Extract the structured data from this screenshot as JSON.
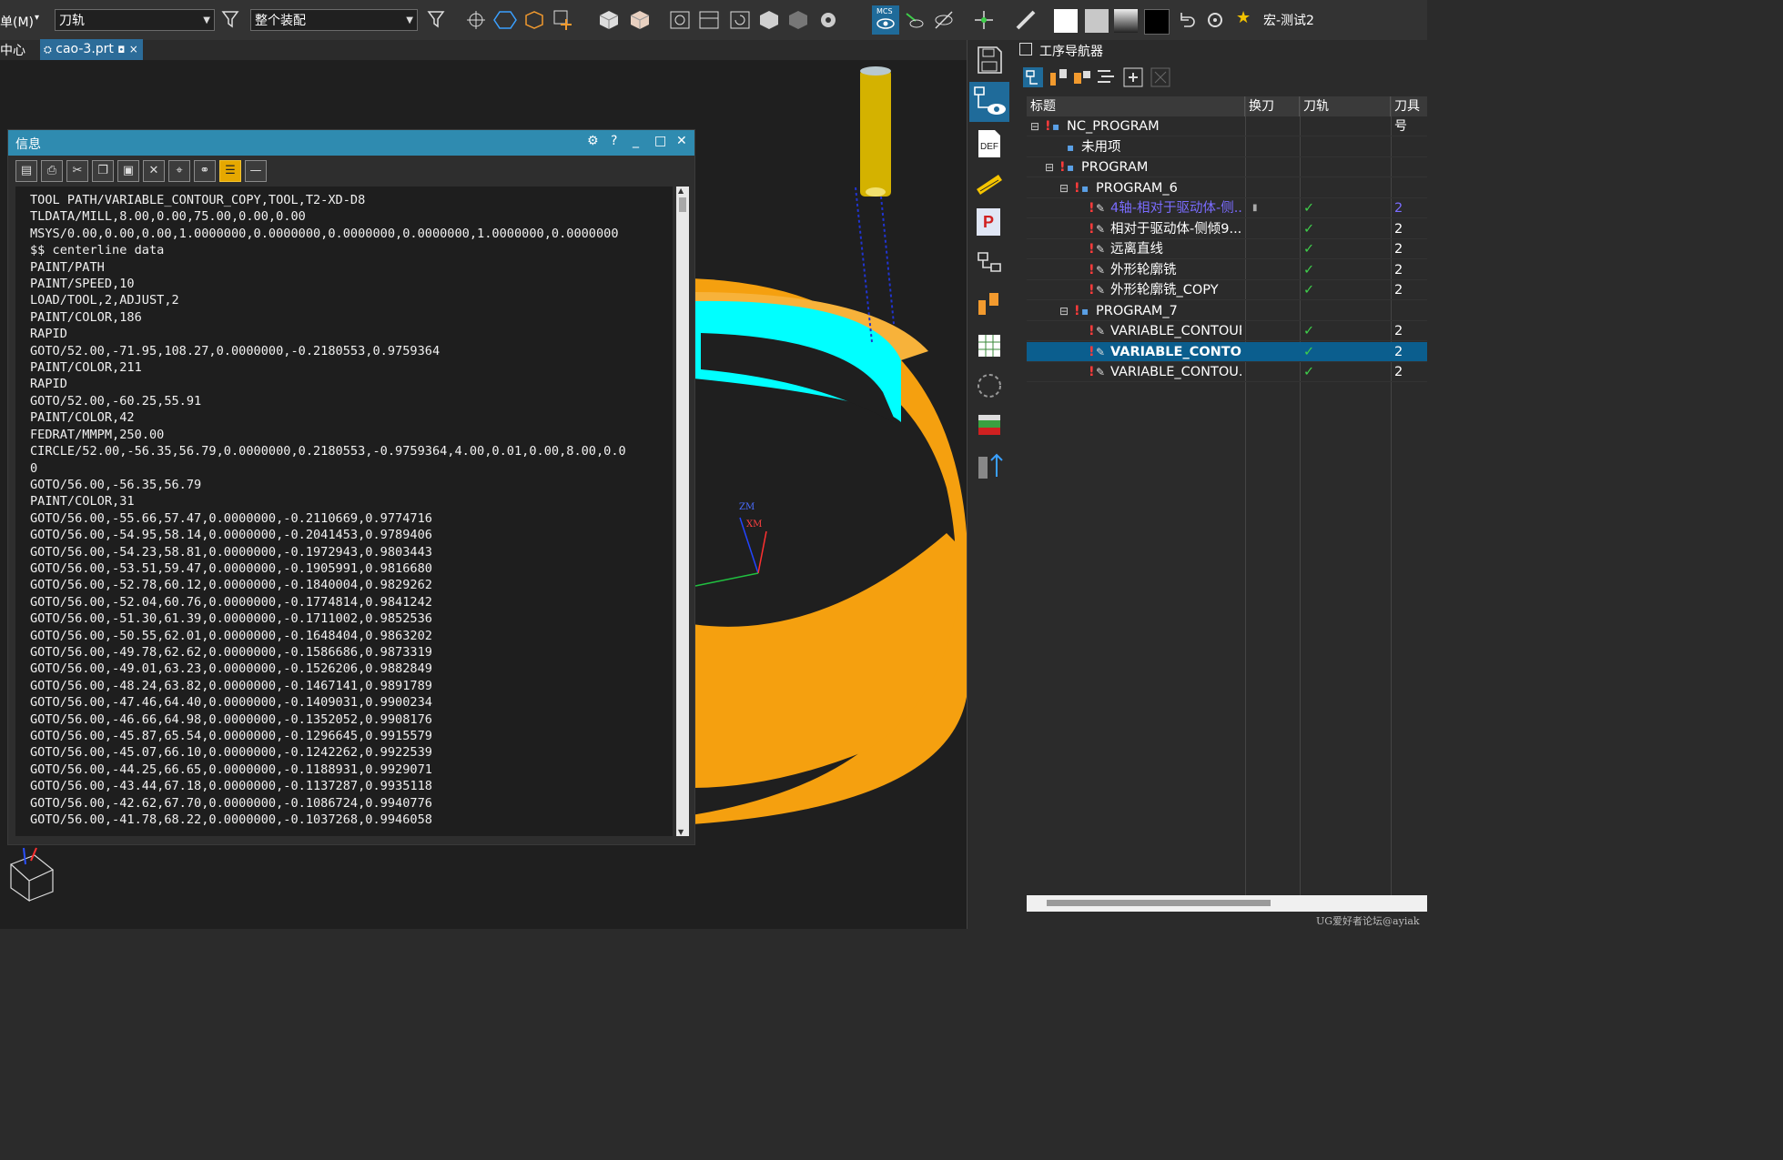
{
  "toolbar": {
    "menu_label": "单(M)",
    "filter_combo": "刀轨",
    "assembly_combo": "整个装配",
    "mcs_badge": "MCS",
    "macro_label": "宏-测试2"
  },
  "tabs": {
    "left_label": "中心",
    "active_tab": "cao-3.prt",
    "active_tab_suffix": "◘"
  },
  "info_dialog": {
    "title": "信息",
    "lines": [
      "TOOL PATH/VARIABLE_CONTOUR_COPY,TOOL,T2-XD-D8",
      "TLDATA/MILL,8.00,0.00,75.00,0.00,0.00",
      "MSYS/0.00,0.00,0.00,1.0000000,0.0000000,0.0000000,0.0000000,1.0000000,0.0000000",
      "$$ centerline data",
      "PAINT/PATH",
      "PAINT/SPEED,10",
      "LOAD/TOOL,2,ADJUST,2",
      "PAINT/COLOR,186",
      "RAPID",
      "GOTO/52.00,-71.95,108.27,0.0000000,-0.2180553,0.9759364",
      "PAINT/COLOR,211",
      "RAPID",
      "GOTO/52.00,-60.25,55.91",
      "PAINT/COLOR,42",
      "FEDRAT/MMPM,250.00",
      "CIRCLE/52.00,-56.35,56.79,0.0000000,0.2180553,-0.9759364,4.00,0.01,0.00,8.00,0.0",
      "0",
      "GOTO/56.00,-56.35,56.79",
      "PAINT/COLOR,31",
      "GOTO/56.00,-55.66,57.47,0.0000000,-0.2110669,0.9774716",
      "GOTO/56.00,-54.95,58.14,0.0000000,-0.2041453,0.9789406",
      "GOTO/56.00,-54.23,58.81,0.0000000,-0.1972943,0.9803443",
      "GOTO/56.00,-53.51,59.47,0.0000000,-0.1905991,0.9816680",
      "GOTO/56.00,-52.78,60.12,0.0000000,-0.1840004,0.9829262",
      "GOTO/56.00,-52.04,60.76,0.0000000,-0.1774814,0.9841242",
      "GOTO/56.00,-51.30,61.39,0.0000000,-0.1711002,0.9852536",
      "GOTO/56.00,-50.55,62.01,0.0000000,-0.1648404,0.9863202",
      "GOTO/56.00,-49.78,62.62,0.0000000,-0.1586686,0.9873319",
      "GOTO/56.00,-49.01,63.23,0.0000000,-0.1526206,0.9882849",
      "GOTO/56.00,-48.24,63.82,0.0000000,-0.1467141,0.9891789",
      "GOTO/56.00,-47.46,64.40,0.0000000,-0.1409031,0.9900234",
      "GOTO/56.00,-46.66,64.98,0.0000000,-0.1352052,0.9908176",
      "GOTO/56.00,-45.87,65.54,0.0000000,-0.1296645,0.9915579",
      "GOTO/56.00,-45.07,66.10,0.0000000,-0.1242262,0.9922539",
      "GOTO/56.00,-44.25,66.65,0.0000000,-0.1188931,0.9929071",
      "GOTO/56.00,-43.44,67.18,0.0000000,-0.1137287,0.9935118",
      "GOTO/56.00,-42.62,67.70,0.0000000,-0.1086724,0.9940776",
      "GOTO/56.00,-41.78,68.22,0.0000000,-0.1037268,0.9946058"
    ]
  },
  "viewport": {
    "axis_zm": "ZM",
    "axis_xm": "XM"
  },
  "navigator": {
    "title": "工序导航器",
    "columns": [
      "标题",
      "换刀",
      "刀轨",
      "刀具号"
    ],
    "rows": [
      {
        "name": "NC_PROGRAM",
        "kind": "root",
        "check": "",
        "toolno": ""
      },
      {
        "name": "未用项",
        "kind": "folder",
        "check": "",
        "toolno": ""
      },
      {
        "name": "PROGRAM",
        "kind": "folder",
        "check": "",
        "toolno": ""
      },
      {
        "name": "PROGRAM_6",
        "kind": "folder",
        "check": "",
        "toolno": ""
      },
      {
        "name": "4轴-相对于驱动体-侧...",
        "kind": "op-active",
        "check": "✓",
        "toolno": "2"
      },
      {
        "name": "相对于驱动体-侧倾9...",
        "kind": "op",
        "check": "✓",
        "toolno": "2"
      },
      {
        "name": "远离直线",
        "kind": "op",
        "check": "✓",
        "toolno": "2"
      },
      {
        "name": "外形轮廓铣",
        "kind": "op",
        "check": "✓",
        "toolno": "2"
      },
      {
        "name": "外形轮廓铣_COPY",
        "kind": "op",
        "check": "✓",
        "toolno": "2"
      },
      {
        "name": "PROGRAM_7",
        "kind": "folder",
        "check": "",
        "toolno": ""
      },
      {
        "name": "VARIABLE_CONTOUR",
        "kind": "op",
        "check": "✓",
        "toolno": "2"
      },
      {
        "name": "VARIABLE_CONTO...",
        "kind": "op-selected",
        "check": "✓",
        "toolno": "2"
      },
      {
        "name": "VARIABLE_CONTOU...",
        "kind": "op",
        "check": "✓",
        "toolno": "2"
      }
    ]
  },
  "watermark": "UG爱好者论坛@ayiak",
  "colors": {
    "title_bar": "#2f8bb0",
    "selection": "#0b5e8e",
    "part": "#f5a00f",
    "toolpath": "#00ffff",
    "check": "#3ecf4a"
  }
}
